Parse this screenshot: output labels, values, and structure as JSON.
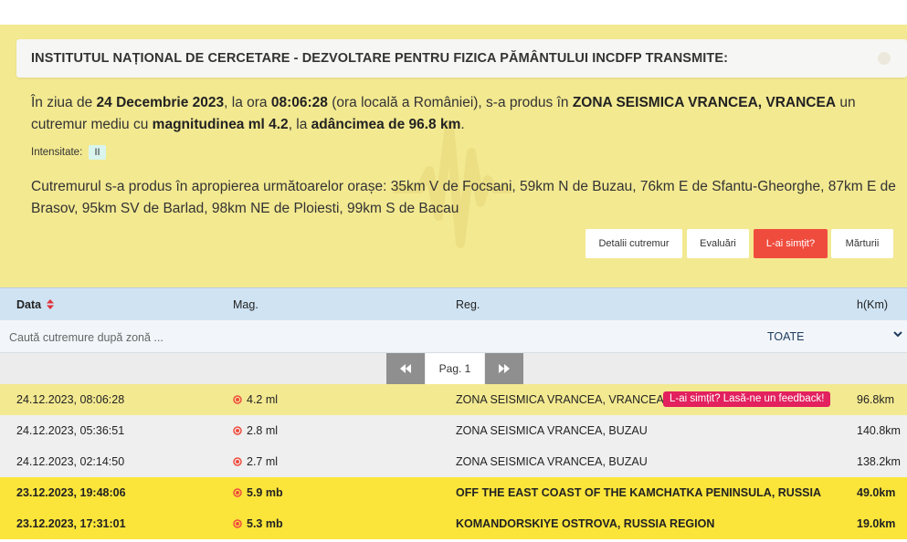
{
  "notice": {
    "header": "INSTITUTUL NAȚIONAL DE CERCETARE - DEZVOLTARE PENTRU FIZICA PĂMÂNTULUI INCDFP TRANSMITE:",
    "p1": "În ziua de ",
    "date": "24 Decembrie 2023",
    "p2": ", la ora ",
    "time": "08:06:28",
    "p3": " (ora locală a României), s-a produs în ",
    "zone": "ZONA SEISMICA VRANCEA, VRANCEA",
    "p4": " un cutremur mediu cu ",
    "magnitude": "magnitudinea ml 4.2",
    "p5": ", la ",
    "depth": "adâncimea de 96.8 km",
    "p6": ".",
    "intensity_label": "Intensitate:",
    "intensity_value": "II",
    "cities": "Cutremurul s-a produs în apropierea următoarelor orașe: 35km V de Focsani, 59km N de Buzau, 76km E de Sfantu-Gheorghe, 87km E de Brasov, 95km SV de Barlad, 98km NE de Ploiesti, 99km S de Bacau"
  },
  "buttons": {
    "details": "Detalii cutremur",
    "ratings": "Evaluări",
    "felt": "L-ai simțit?",
    "testimonies": "Mărturii"
  },
  "table": {
    "columns": {
      "date": "Data",
      "mag": "Mag.",
      "region": "Reg.",
      "depth": "h(Km)"
    },
    "search_placeholder": "Caută cutremure după zonă ...",
    "region_filter": "TOATE",
    "page_label": "Pag. 1",
    "feedback_badge": "L-ai simțit? Lasă-ne un feedback!",
    "rows": [
      {
        "date": "24.12.2023, 08:06:28",
        "mag": "4.2 ml",
        "region": "ZONA SEISMICA VRANCEA, VRANCEA",
        "depth": "96.8km"
      },
      {
        "date": "24.12.2023, 05:36:51",
        "mag": "2.8 ml",
        "region": "ZONA SEISMICA VRANCEA, BUZAU",
        "depth": "140.8km"
      },
      {
        "date": "24.12.2023, 02:14:50",
        "mag": "2.7 ml",
        "region": "ZONA SEISMICA VRANCEA, BUZAU",
        "depth": "138.2km"
      },
      {
        "date": "23.12.2023, 19:48:06",
        "mag": "5.9 mb",
        "region": "OFF THE EAST COAST OF THE KAMCHATKA PENINSULA, RUSSIA",
        "depth": "49.0km"
      },
      {
        "date": "23.12.2023, 17:31:01",
        "mag": "5.3 mb",
        "region": "KOMANDORSKIYE OSTROVA, RUSSIA REGION",
        "depth": "19.0km"
      }
    ]
  },
  "colors": {
    "panel_bg": "#f3e991",
    "felt_button": "#f04c3e",
    "feedback_badge": "#e2215e",
    "header_row": "#cfe3f3",
    "row_highlight_light": "#f3e991",
    "row_highlight_strong": "#fbe53a",
    "row_default": "#efefef",
    "magnitude_icon": "#f04c3e"
  }
}
